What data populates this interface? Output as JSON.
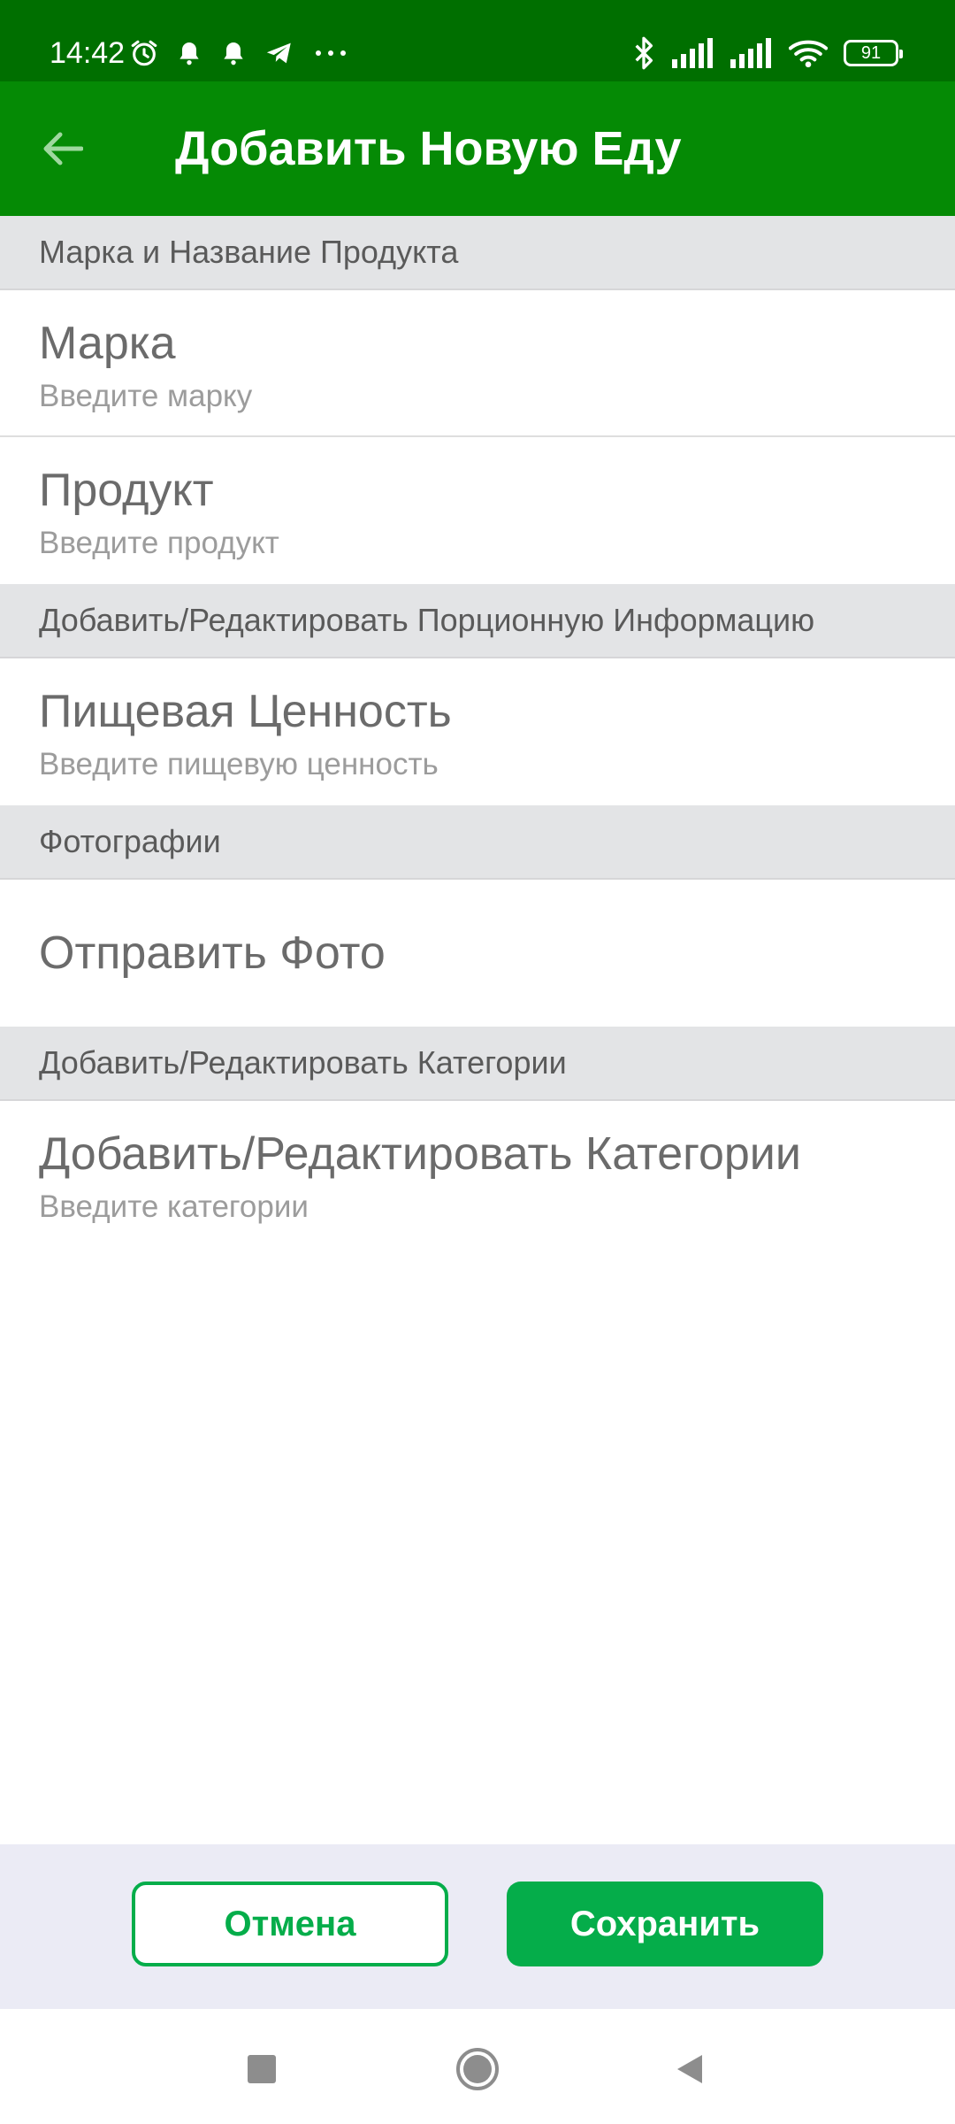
{
  "status_bar": {
    "time": "14:42",
    "battery": "91",
    "icons_left": [
      "alarm-icon",
      "bell-icon",
      "bell-icon",
      "telegram-icon",
      "more-dots-icon"
    ],
    "icons_right": [
      "bluetooth-icon",
      "signal-icon",
      "signal-icon",
      "wifi-icon",
      "battery-icon"
    ]
  },
  "app_bar": {
    "title": "Добавить Новую Еду",
    "back_icon": "arrow-back-icon"
  },
  "sections": {
    "brand": {
      "header": "Марка и Название Продукта",
      "brand_title": "Марка",
      "brand_sub": "Введите марку",
      "product_title": "Продукт",
      "product_sub": "Введите продукт"
    },
    "serving": {
      "header": "Добавить/Редактировать Порционную Информацию",
      "nutrition_title": "Пищевая Ценность",
      "nutrition_sub": "Введите пищевую ценность"
    },
    "photos": {
      "header": "Фотографии",
      "send_photo": "Отправить Фото"
    },
    "categories": {
      "header": "Добавить/Редактировать Категории",
      "title": "Добавить/Редактировать Категории",
      "sub": "Введите категории"
    }
  },
  "buttons": {
    "cancel": "Отмена",
    "save": "Сохранить"
  },
  "colors": {
    "status_bar": "#006f00",
    "app_bar": "#058a05",
    "accent": "#05ad4a"
  },
  "nav_bar": {
    "icons": [
      "recents-square-icon",
      "home-circle-icon",
      "back-triangle-icon"
    ]
  }
}
